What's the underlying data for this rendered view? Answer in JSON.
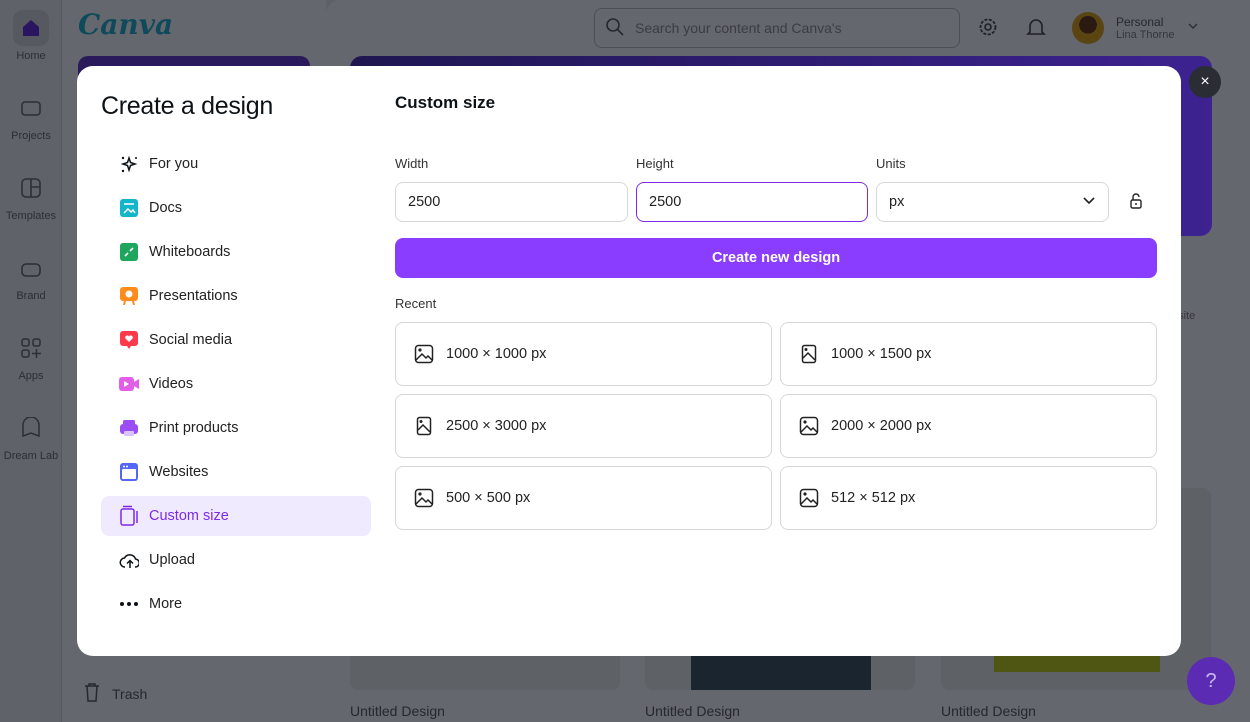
{
  "app": {
    "logo": "Canva"
  },
  "rail": [
    {
      "label": "Home",
      "icon": "home-icon"
    },
    {
      "label": "Projects",
      "icon": "folder-icon"
    },
    {
      "label": "Templates",
      "icon": "templates-icon"
    },
    {
      "label": "Brand",
      "icon": "brand-icon"
    },
    {
      "label": "Apps",
      "icon": "apps-icon"
    },
    {
      "label": "Dream Lab",
      "icon": "dream-lab-icon"
    }
  ],
  "sidebar": {
    "trash": "Trash"
  },
  "header": {
    "search_placeholder": "Search your content and Canva's",
    "account_type": "Personal",
    "user_name": "Lina Thorne"
  },
  "background": {
    "thumbnails": [
      "Untitled Design",
      "Untitled Design",
      "Untitled Design"
    ],
    "partial_label": "bsite",
    "help": "?"
  },
  "modal": {
    "title": "Create a design",
    "close": "×",
    "nav": [
      {
        "label": "For you",
        "icon": "sparkles-icon",
        "color": "#0d1216"
      },
      {
        "label": "Docs",
        "icon": "docs-icon",
        "color": "#13b5cb"
      },
      {
        "label": "Whiteboards",
        "icon": "whiteboard-icon",
        "color": "#1ea55e"
      },
      {
        "label": "Presentations",
        "icon": "presentation-icon",
        "color": "#ff8b1a"
      },
      {
        "label": "Social media",
        "icon": "heart-icon",
        "color": "#ff3b4b"
      },
      {
        "label": "Videos",
        "icon": "video-icon",
        "color": "#e35ee8"
      },
      {
        "label": "Print products",
        "icon": "printer-icon",
        "color": "#9b4ef6"
      },
      {
        "label": "Websites",
        "icon": "website-icon",
        "color": "#5467f5"
      },
      {
        "label": "Custom size",
        "icon": "custom-size-icon",
        "color": "#7d2ae8",
        "active": true
      },
      {
        "label": "Upload",
        "icon": "upload-cloud-icon",
        "color": "#0d1216"
      },
      {
        "label": "More",
        "icon": "more-icon",
        "color": "#0d1216"
      }
    ],
    "custom": {
      "title": "Custom size",
      "width_label": "Width",
      "width_value": "2500",
      "height_label": "Height",
      "height_value": "2500",
      "units_label": "Units",
      "units_value": "px",
      "create_button": "Create new design",
      "recent_label": "Recent",
      "recent": [
        {
          "label": "1000 × 1000 px",
          "icon": "image-icon"
        },
        {
          "label": "1000 × 1500 px",
          "icon": "portrait-image-icon"
        },
        {
          "label": "2500 × 3000 px",
          "icon": "portrait-image-icon"
        },
        {
          "label": "2000 × 2000 px",
          "icon": "image-icon"
        },
        {
          "label": "500 × 500 px",
          "icon": "image-icon"
        },
        {
          "label": "512 × 512 px",
          "icon": "image-icon"
        }
      ]
    }
  },
  "colors": {
    "accent": "#8b3dff",
    "active_bg": "#f0eafe",
    "active_text": "#7d2ae8"
  }
}
